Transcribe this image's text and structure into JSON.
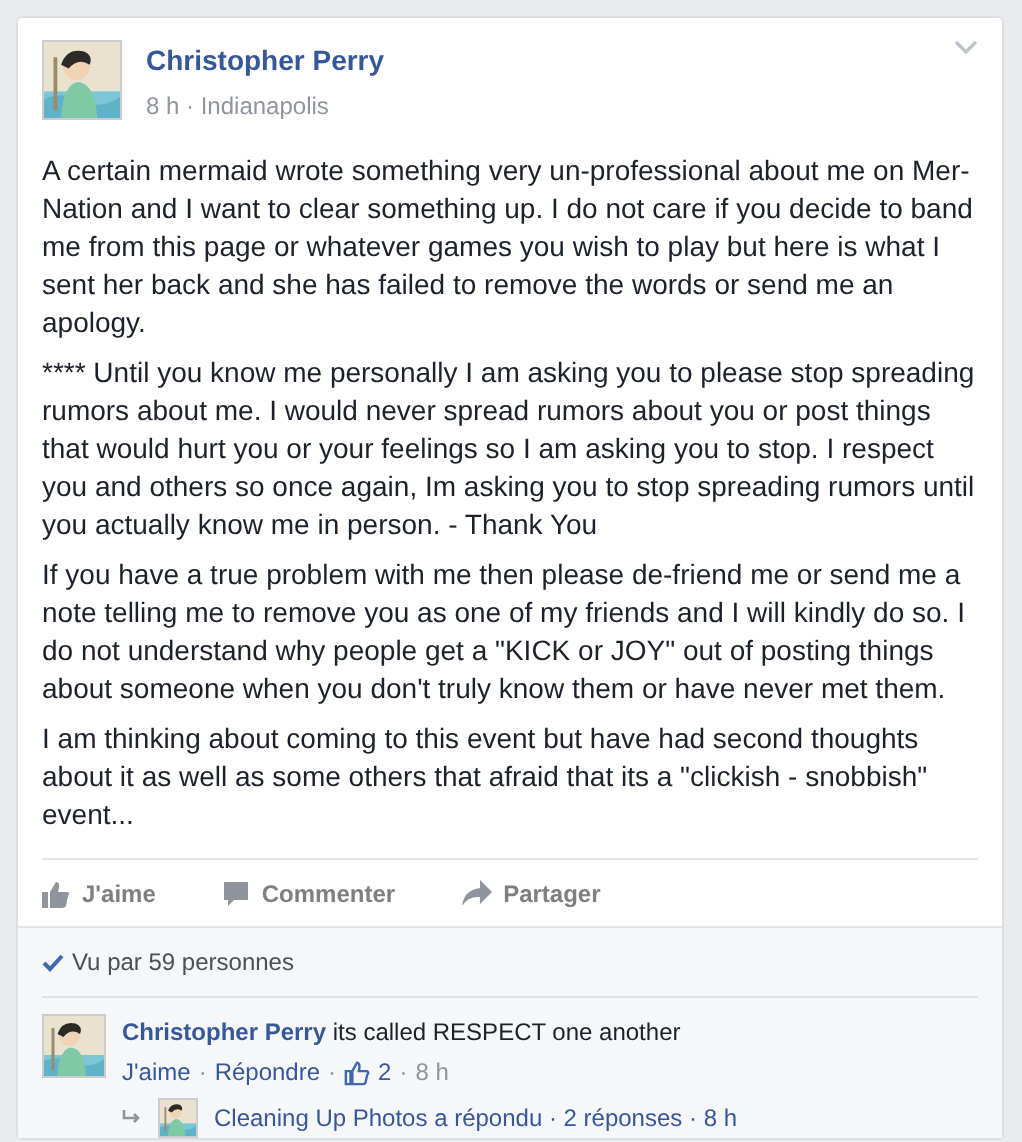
{
  "post": {
    "author": "Christopher Perry",
    "separator": "·",
    "time": "8 h",
    "location": "Indianapolis",
    "paragraphs": [
      "A certain mermaid wrote something very un-professional about me on Mer-Nation and I want to clear something up. I do not care if you decide to band me from this page or whatever games you wish to play but here is what I sent her back and she has failed to remove the words or send me an apology.",
      "**** Until you know me personally I am asking you to please stop spreading rumors about me. I would never spread rumors about you or post things that would hurt you or your feelings so I am asking you to stop. I respect you and others so once again, Im asking you to stop spreading rumors until you actually know me in person. - Thank You",
      "If you have a true problem with me then please de-friend me or send me a note telling me to remove you as one of my friends and I will kindly do so. I do not understand why people get a \"KICK or JOY\" out of posting things about someone when you don't truly know them or have never met them.",
      "I am thinking about coming to this event but have had second thoughts about it as well as some others that afraid that its a \"clickish - snobbish\" event..."
    ],
    "actions": [
      {
        "kind": "like",
        "label": "J'aime"
      },
      {
        "kind": "comment",
        "label": "Commenter"
      },
      {
        "kind": "share",
        "label": "Partager"
      }
    ],
    "seen_by": "Vu par 59 personnes",
    "comments": [
      {
        "author": "Christopher Perry",
        "text": "its called RESPECT one another",
        "like": "J'aime",
        "reply": "Répondre",
        "likes": "2",
        "time": "8 h",
        "replies": {
          "author": "Cleaning Up Photos",
          "text": "a répondu",
          "count": "2 réponses",
          "time": "8 h"
        }
      }
    ]
  }
}
